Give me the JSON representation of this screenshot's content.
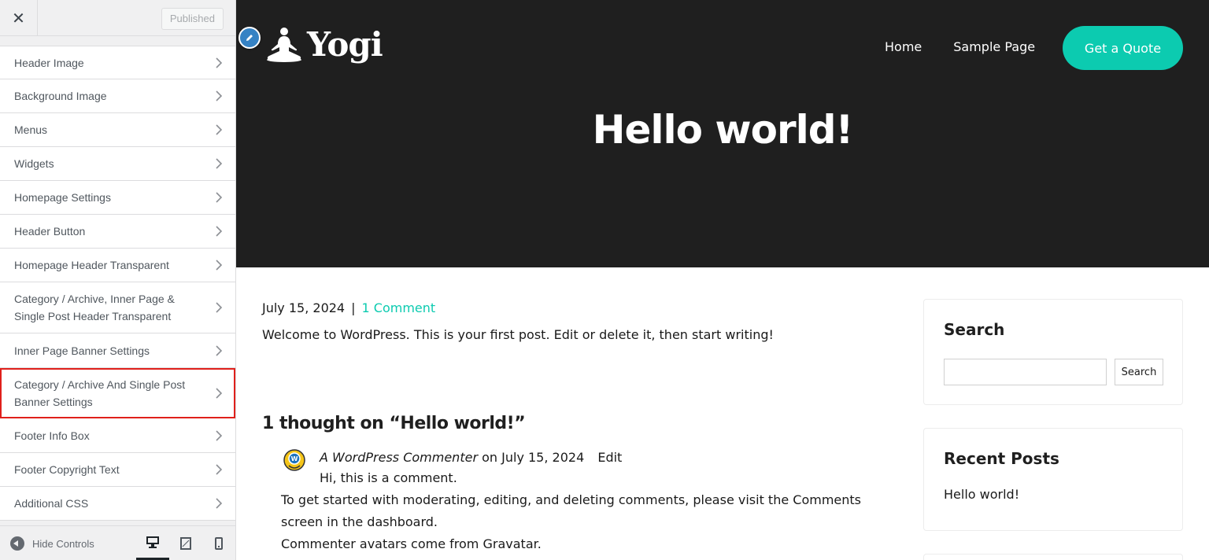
{
  "customizer": {
    "close_icon": "close-icon",
    "published_label": "Published",
    "sections": [
      {
        "label": "Header Image"
      },
      {
        "label": "Background Image"
      },
      {
        "label": "Menus"
      },
      {
        "label": "Widgets"
      },
      {
        "label": "Homepage Settings"
      },
      {
        "label": "Header Button"
      },
      {
        "label": "Homepage Header Transparent"
      },
      {
        "label": "Category / Archive, Inner Page & Single Post Header Transparent"
      },
      {
        "label": "Inner Page Banner Settings"
      },
      {
        "label": "Category / Archive And Single Post Banner Settings",
        "highlighted": true
      },
      {
        "label": "Footer Info Box"
      },
      {
        "label": "Footer Copyright Text"
      },
      {
        "label": "Additional CSS"
      }
    ],
    "hide_controls_label": "Hide Controls",
    "devices": [
      "desktop",
      "tablet",
      "mobile"
    ],
    "active_device": "desktop"
  },
  "site": {
    "logo_text": "Yogi",
    "nav": [
      "Home",
      "Sample Page"
    ],
    "cta_label": "Get a Quote",
    "hero_title": "Hello world!",
    "post": {
      "date": "July 15, 2024",
      "separator": "|",
      "comments_link": "1 Comment",
      "body": "Welcome to WordPress. This is your first post. Edit or delete it, then start writing!"
    },
    "comments": {
      "title": "1 thought on “Hello world!”",
      "author": "A WordPress Commenter",
      "on_word": "on",
      "date": "July 15, 2024",
      "edit_label": "Edit",
      "first_line": "Hi, this is a comment.",
      "line2": "To get started with moderating, editing, and deleting comments, please visit the Comments screen in the dashboard.",
      "line3_prefix": "Commenter avatars come from ",
      "line3_link": "Gravatar",
      "line3_suffix": "."
    },
    "sidebar": {
      "search_title": "Search",
      "search_button": "Search",
      "recent_title": "Recent Posts",
      "recent_item": "Hello world!"
    }
  },
  "colors": {
    "accent": "#0ccbb0",
    "hero_bg": "#1f1f1f",
    "highlight_border": "#e0201b",
    "edit_shortcut": "#3582c4"
  }
}
